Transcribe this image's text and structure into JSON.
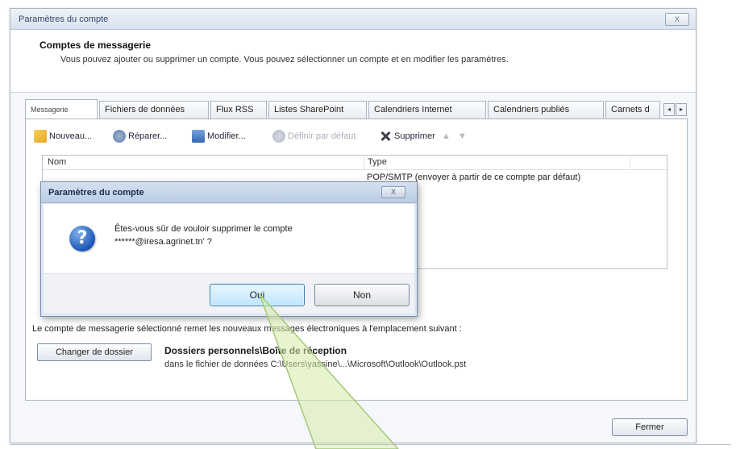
{
  "window": {
    "title": "Paramètres du compte",
    "close_label": "X"
  },
  "header": {
    "title": "Comptes de messagerie",
    "description": "Vous pouvez ajouter ou supprimer un compte. Vous pouvez sélectionner un compte et en modifier les paramètres."
  },
  "tabs": [
    {
      "label": "Messagerie",
      "active": true
    },
    {
      "label": "Fichiers de données"
    },
    {
      "label": "Flux RSS"
    },
    {
      "label": "Listes SharePoint"
    },
    {
      "label": "Calendriers Internet"
    },
    {
      "label": "Calendriers publiés"
    },
    {
      "label": "Carnets d"
    }
  ],
  "tab_scroll": {
    "left": "◂",
    "right": "▸"
  },
  "toolbar": {
    "new": "Nouveau...",
    "repair": "Réparer...",
    "modify": "Modifier...",
    "default": "Définir par défaut",
    "delete": "Supprimer",
    "up_icon": "▲",
    "down_icon": "▼"
  },
  "list": {
    "col_name": "Nom",
    "col_type": "Type",
    "row_type": "POP/SMTP (envoyer à partir de ce compte par défaut)"
  },
  "info_line": "Le compte de messagerie sélectionné remet les nouveaux messages électroniques à l'emplacement suivant :",
  "change_folder": "Changer de dossier",
  "folder_title": "Dossiers personnels\\Boîte de réception",
  "folder_path": "dans le fichier de données C:\\Users\\yassine\\...\\Microsoft\\Outlook\\Outlook.pst",
  "close_button": "Fermer",
  "dialog": {
    "title": "Paramètres du compte",
    "close_label": "X",
    "message_line1": "Êtes-vous sûr de vouloir supprimer le compte",
    "message_line2": "******@iresa.agrinet.tn' ?",
    "yes": "Oui",
    "no": "Non",
    "icon_glyph": "?"
  }
}
